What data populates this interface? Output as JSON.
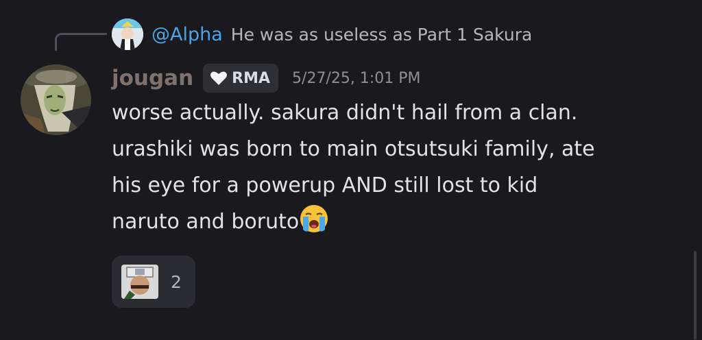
{
  "reply": {
    "author": "@Alpha",
    "text": "He was as useless as Part 1 Sakura"
  },
  "message": {
    "username": "jougan",
    "tag": "RMA",
    "timestamp": "5/27/25, 1:01 PM",
    "lines": [
      "worse actually. sakura didn't hail from a clan.",
      "urashiki was born to main otsutsuki family, ate",
      "his eye for a powerup AND still lost to kid",
      "naruto and boruto"
    ],
    "emoji": "loudly-crying-face"
  },
  "reaction": {
    "count": "2"
  },
  "colors": {
    "background": "#1a1a1e",
    "mention": "#4aa4e8",
    "username": "#7f726e"
  }
}
